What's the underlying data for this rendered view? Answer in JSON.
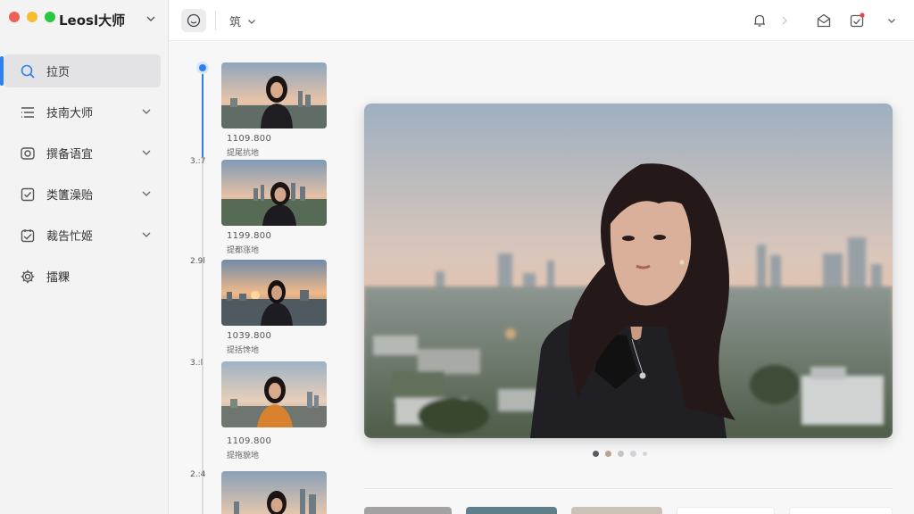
{
  "app": {
    "title": "Leosl大师",
    "traffic_colors": [
      "#ee5f57",
      "#f5bd2f",
      "#29c840"
    ]
  },
  "sidebar": {
    "items": [
      {
        "label": "拉页",
        "icon": "search-icon",
        "active": true
      },
      {
        "label": "技南大师",
        "icon": "list-icon",
        "has_chevron": true
      },
      {
        "label": "撰备语宜",
        "icon": "camera-icon",
        "has_chevron": true
      },
      {
        "label": "类籄澡贻",
        "icon": "checkbox-icon",
        "has_chevron": true
      },
      {
        "label": "裁告忙姬",
        "icon": "calendar-icon",
        "has_chevron": true
      },
      {
        "label": "擂粿",
        "icon": "gear-icon"
      }
    ]
  },
  "topbar": {
    "filter_label": "筑",
    "icons": [
      "face-icon",
      "bell-icon",
      "chevron-right-icon",
      "mail-icon",
      "calendar-check-icon",
      "chevron-down-icon"
    ]
  },
  "timeline": {
    "labels": [
      "3.:7",
      "2.9l",
      "3.:l",
      "2.:4"
    ],
    "items": [
      {
        "res": "1109.800",
        "sub": "提尾抗地"
      },
      {
        "res": "1199.800",
        "sub": "提都涨地"
      },
      {
        "res": "1039.800",
        "sub": "提括馋地"
      },
      {
        "res": "1109.800",
        "sub": "提拖貌地"
      }
    ]
  },
  "preview": {
    "page_dots": 5,
    "active_dot": 0,
    "dot_colors": [
      "#5b5b5f",
      "#b8a58c",
      "#c4c4c8",
      "#d4d4d8",
      "#d4d4d8"
    ]
  },
  "colors": {
    "accent": "#2f80ed"
  }
}
